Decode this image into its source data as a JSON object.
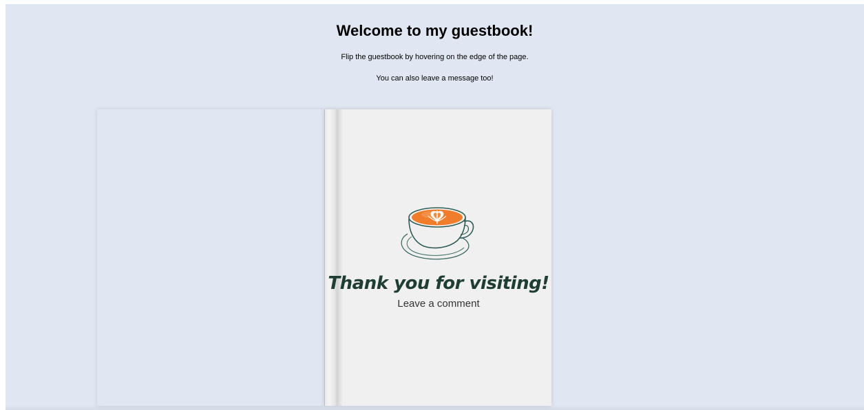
{
  "page": {
    "heading": "Welcome to my guestbook!",
    "instructions": [
      "Flip the guestbook by hovering on the edge of the page.",
      "You can also leave a message too!"
    ]
  },
  "guestbook": {
    "cover": {
      "title": "Thank you for visiting!",
      "cta_label": "Leave a comment",
      "illustration": "coffee-cup-latte-art-icon"
    }
  },
  "colors": {
    "background": "#e0e7f3",
    "page": "#f0f0f0",
    "title_ink": "#1f3d33",
    "latte": "#ef7d2c"
  }
}
